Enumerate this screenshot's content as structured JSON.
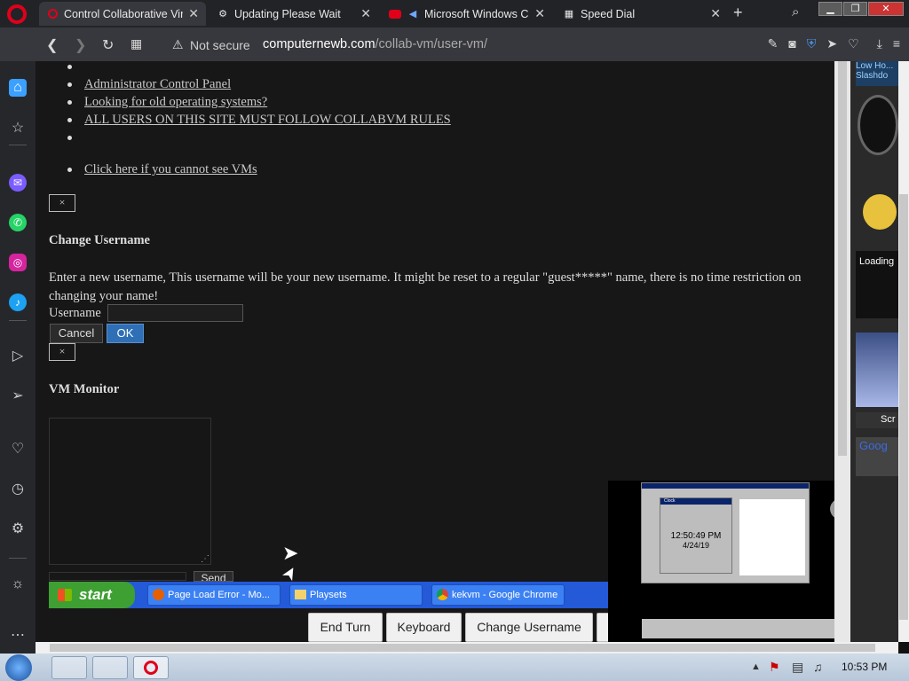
{
  "tabs": [
    {
      "label": "Control Collaborative Virtu",
      "icon": "opera-tab-icon",
      "active": true
    },
    {
      "label": "Updating Please Wait",
      "icon": "puzzle-icon",
      "active": false
    },
    {
      "label": "Microsoft Windows Ch",
      "icon": "youtube-icon",
      "active": false
    },
    {
      "label": "Speed Dial",
      "icon": "grid-icon",
      "active": false
    }
  ],
  "address": {
    "security": "Not secure",
    "domain": "computernewb.com",
    "path": "/collab-vm/user-vm/"
  },
  "links": [
    "Administrator Control Panel",
    "Looking for old operating systems?",
    "ALL USERS ON THIS SITE MUST FOLLOW COLLABVM RULES",
    "Click here if you cannot see VMs"
  ],
  "change_username": {
    "title": "Change Username",
    "description": "Enter a new username, This username will be your new username. It might be reset to a regular \"guest*****\" name, there is no time restriction on changing your name!",
    "field_label": "Username",
    "field_value": "",
    "cancel": "Cancel",
    "ok": "OK"
  },
  "vm_monitor": {
    "title": "VM Monitor"
  },
  "close_glyph": "×",
  "send_label": "Send",
  "xp_taskbar": {
    "start": "start",
    "items": [
      "Page Load Error - Mo...",
      "Playsets",
      "kekvm - Google Chrome"
    ]
  },
  "action_buttons": [
    "End Turn",
    "Keyboard",
    "Change Username"
  ],
  "vm_screen": {
    "clock_time": "12:50:49 PM",
    "clock_date": "4/24/19",
    "clock_title": "Clock"
  },
  "widgets": {
    "rss_text": "Low Ho... Slashdo",
    "loading": "Loading",
    "scr": "Scr",
    "google": "Goog"
  },
  "system_clock": "10:53 PM",
  "colors": {
    "page_bg": "#171717",
    "tab_bar": "#222327",
    "address_bar": "#37383d",
    "ok_button": "#2f6fb5",
    "xp_start": "#3e9f33",
    "xp_taskbar": "#2459d8",
    "opera_red": "#e0001a"
  }
}
